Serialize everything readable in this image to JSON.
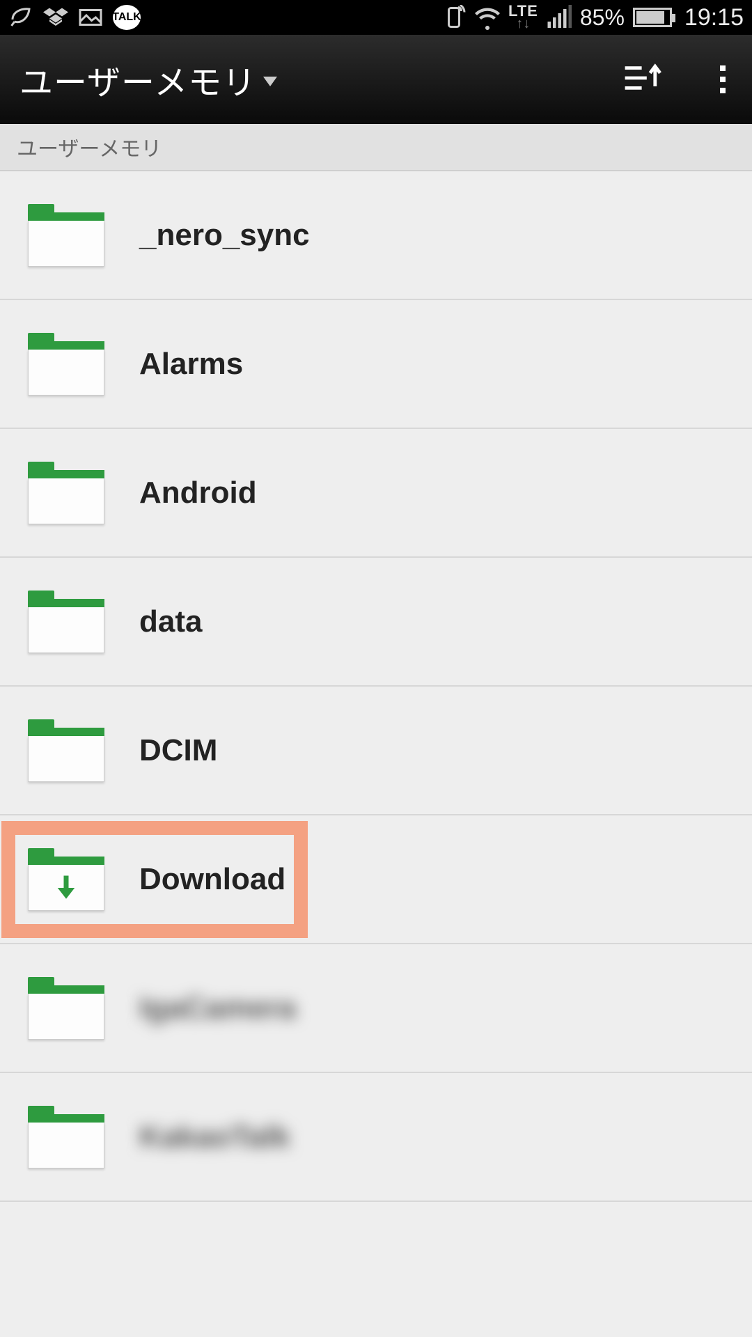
{
  "status_bar": {
    "network_label": "LTE",
    "battery_pct": "85%",
    "clock": "19:15",
    "talk_label": "TALK"
  },
  "action_bar": {
    "title": "ユーザーメモリ"
  },
  "breadcrumb": {
    "path": "ユーザーメモリ"
  },
  "folders": [
    {
      "name": "_nero_sync",
      "download_icon": false,
      "highlighted": false,
      "blurred": false
    },
    {
      "name": "Alarms",
      "download_icon": false,
      "highlighted": false,
      "blurred": false
    },
    {
      "name": "Android",
      "download_icon": false,
      "highlighted": false,
      "blurred": false
    },
    {
      "name": "data",
      "download_icon": false,
      "highlighted": false,
      "blurred": false
    },
    {
      "name": "DCIM",
      "download_icon": false,
      "highlighted": false,
      "blurred": false
    },
    {
      "name": "Download",
      "download_icon": true,
      "highlighted": true,
      "blurred": false
    },
    {
      "name": "IgaCamera",
      "download_icon": false,
      "highlighted": false,
      "blurred": true
    },
    {
      "name": "KakaoTalk",
      "download_icon": false,
      "highlighted": false,
      "blurred": true
    }
  ],
  "colors": {
    "highlight": "#f4a182",
    "folder_accent": "#2e9b3f"
  }
}
